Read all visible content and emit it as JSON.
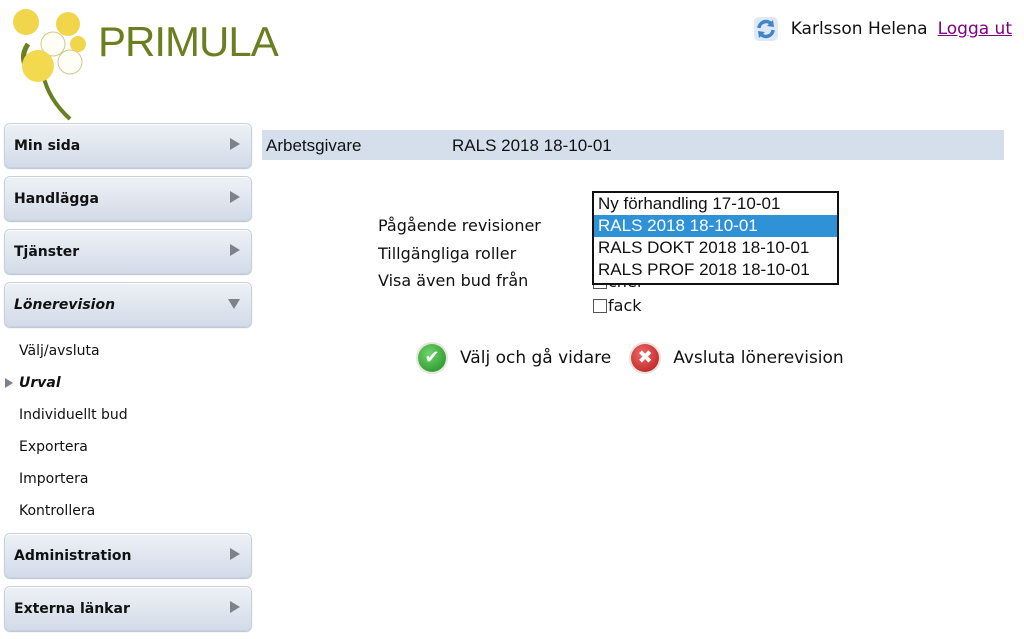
{
  "header": {
    "logo_text": "PRIMULA",
    "user_name": "Karlsson Helena",
    "logout_label": "Logga ut",
    "refresh_icon": "refresh-icon"
  },
  "sidebar": {
    "items": [
      {
        "label": "Min sida",
        "state": "collapsed"
      },
      {
        "label": "Handlägga",
        "state": "collapsed"
      },
      {
        "label": "Tjänster",
        "state": "collapsed"
      },
      {
        "label": "Lönerevision",
        "state": "expanded"
      },
      {
        "label": "Administration",
        "state": "collapsed"
      },
      {
        "label": "Externa länkar",
        "state": "collapsed"
      }
    ],
    "subitems": [
      {
        "label": "Välj/avsluta"
      },
      {
        "label": "Urval",
        "active": true
      },
      {
        "label": "Individuellt bud"
      },
      {
        "label": "Exportera"
      },
      {
        "label": "Importera"
      },
      {
        "label": "Kontrollera"
      }
    ]
  },
  "infobar": {
    "key": "Arbetsgivare",
    "value": "RALS 2018 18-10-01"
  },
  "form": {
    "label_revisions": "Pågående revisioner",
    "label_roles": "Tillgängliga roller",
    "label_show_bids": "Visa även bud från",
    "checkbox_chef": "chef",
    "checkbox_fack": "fack",
    "revision_options": [
      "Ny förhandling 17-10-01",
      "RALS 2018 18-10-01",
      "RALS DOKT 2018 18-10-01",
      "RALS PROF 2018 18-10-01"
    ],
    "selected_revision": "RALS 2018 18-10-01"
  },
  "actions": {
    "continue_label": "Välj och gå vidare",
    "exit_label": "Avsluta lönerevision"
  },
  "colors": {
    "brand_green": "#6a7f1f",
    "selection_blue": "#2f91d6",
    "infobar_bg": "#d5dfeb",
    "logout_link": "#800080"
  }
}
